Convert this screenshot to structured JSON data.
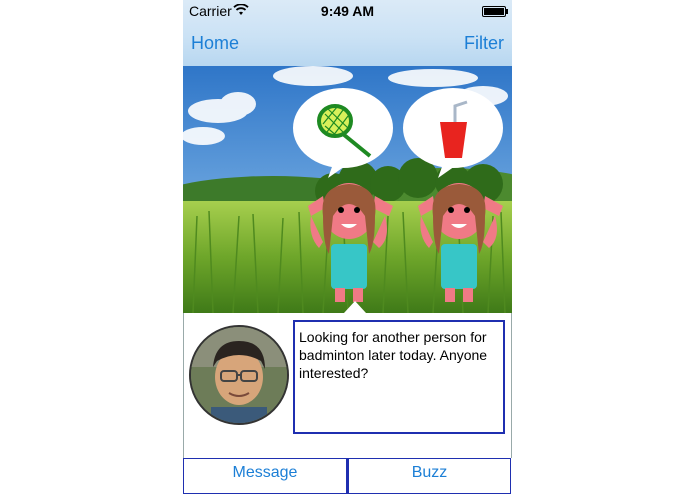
{
  "status_bar": {
    "carrier": "Carrier",
    "time": "9:49 AM"
  },
  "nav": {
    "left_label": "Home",
    "right_label": "Filter"
  },
  "scene": {
    "characters": [
      {
        "name": "left-girl",
        "bubble_icon": "badminton-racket-icon"
      },
      {
        "name": "right-girl",
        "bubble_icon": "drink-cup-icon"
      }
    ]
  },
  "post": {
    "avatar": "user-avatar",
    "message": "Looking for another person for badminton later today. Anyone interested?"
  },
  "actions": {
    "message_label": "Message",
    "buzz_label": "Buzz"
  },
  "colors": {
    "accent": "#1c7fd6",
    "box_border": "#1f2fb0",
    "navbar": "#cbe2f5"
  }
}
